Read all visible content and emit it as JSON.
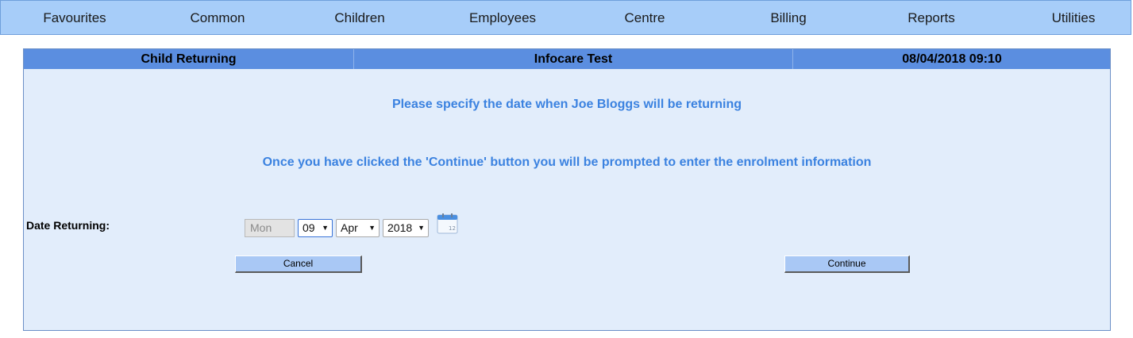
{
  "nav": {
    "items": [
      {
        "label": "Favourites"
      },
      {
        "label": "Common"
      },
      {
        "label": "Children"
      },
      {
        "label": "Employees"
      },
      {
        "label": "Centre"
      },
      {
        "label": "Billing"
      },
      {
        "label": "Reports"
      },
      {
        "label": "Utilities"
      }
    ]
  },
  "header": {
    "page_title": "Child Returning",
    "centre_name": "Infocare Test",
    "datetime": "08/04/2018 09:10"
  },
  "messages": {
    "specify": "Please specify the date when Joe Bloggs will be returning",
    "continue_note": "Once you have clicked the 'Continue' button you will be prompted to enter the enrolment information"
  },
  "form": {
    "date_label": "Date Returning:",
    "weekday": "Mon",
    "day": "09",
    "month": "Apr",
    "year": "2018",
    "calendar_icon": "calendar-icon"
  },
  "buttons": {
    "cancel": "Cancel",
    "continue": "Continue"
  },
  "colors": {
    "nav_bg": "#a7cdf9",
    "header_bg": "#5b8ee0",
    "panel_bg": "#e2edfb",
    "message_text": "#3b82e0",
    "button_bg": "#a9c8f5"
  }
}
